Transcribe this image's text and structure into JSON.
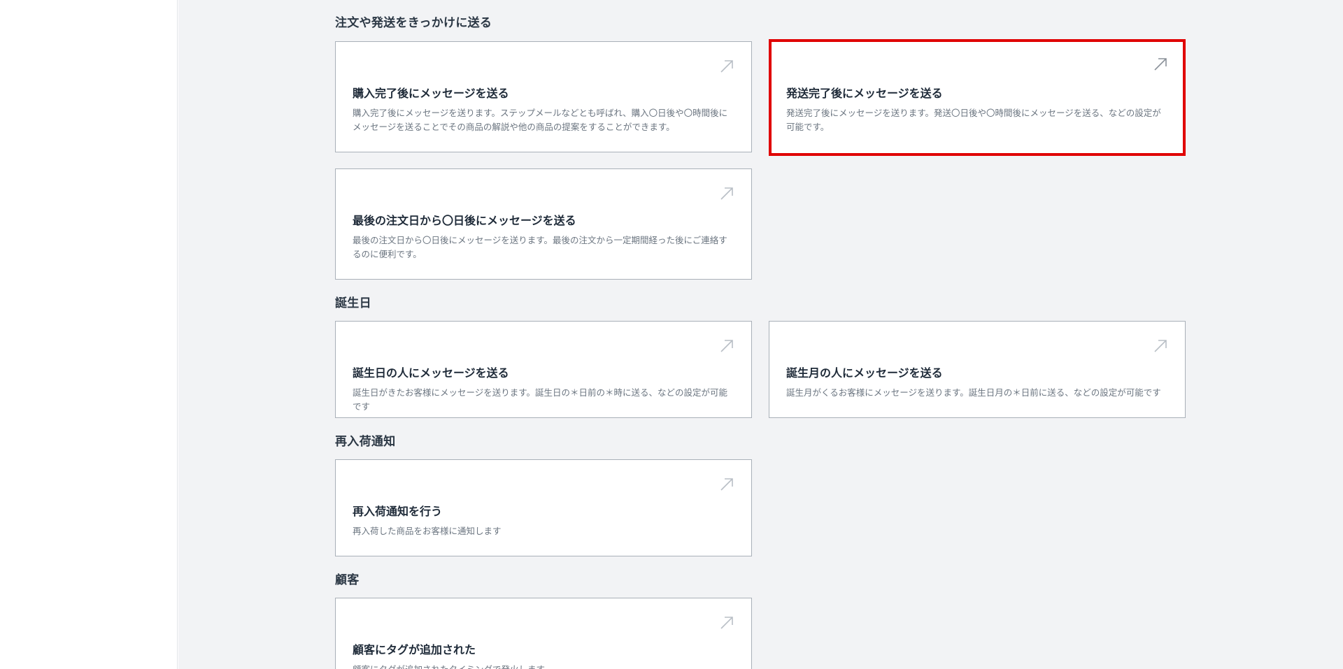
{
  "sections": [
    {
      "title": "注文や発送をきっかけに送る",
      "cards": [
        {
          "title": "購入完了後にメッセージを送る",
          "description": "購入完了後にメッセージを送ります。ステップメールなどとも呼ばれ、購入〇日後や〇時間後にメッセージを送ることでその商品の解説や他の商品の提案をすることができます。"
        },
        {
          "title": "発送完了後にメッセージを送る",
          "description": "発送完了後にメッセージを送ります。発送〇日後や〇時間後にメッセージを送る、などの設定が可能です。"
        },
        {
          "title": "最後の注文日から〇日後にメッセージを送る",
          "description": "最後の注文日から〇日後にメッセージを送ります。最後の注文から一定期間経った後にご連絡するのに便利です。"
        }
      ]
    },
    {
      "title": "誕生日",
      "cards": [
        {
          "title": "誕生日の人にメッセージを送る",
          "description": "誕生日がきたお客様にメッセージを送ります。誕生日の＊日前の＊時に送る、などの設定が可能です"
        },
        {
          "title": "誕生月の人にメッセージを送る",
          "description": "誕生月がくるお客様にメッセージを送ります。誕生日月の＊日前に送る、などの設定が可能です"
        }
      ]
    },
    {
      "title": "再入荷通知",
      "cards": [
        {
          "title": "再入荷通知を行う",
          "description": "再入荷した商品をお客様に通知します"
        }
      ]
    },
    {
      "title": "顧客",
      "cards": [
        {
          "title": "顧客にタグが追加された",
          "description": "顧客にタグが追加されたタイミングで発火します"
        }
      ]
    }
  ],
  "highlight_color": "#e00000",
  "card_icon": "arrow-up-right-icon"
}
